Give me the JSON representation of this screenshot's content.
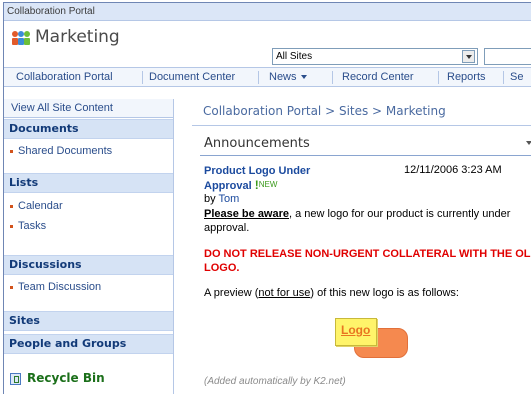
{
  "topbar": {
    "portal_name": "Collaboration Portal"
  },
  "site": {
    "title": "Marketing"
  },
  "search": {
    "scope_value": "All Sites",
    "query_value": ""
  },
  "topnav": {
    "tabs": [
      {
        "label": "Collaboration Portal"
      },
      {
        "label": "Document Center"
      },
      {
        "label": "News"
      },
      {
        "label": "Record Center"
      },
      {
        "label": "Reports"
      },
      {
        "label": "Se"
      }
    ]
  },
  "quicklaunch": {
    "view_all": "View All Site Content",
    "documents_header": "Documents",
    "documents_items": [
      "Shared Documents"
    ],
    "lists_header": "Lists",
    "lists_items": [
      "Calendar",
      "Tasks"
    ],
    "discussions_header": "Discussions",
    "discussions_items": [
      "Team Discussion"
    ],
    "sites_header": "Sites",
    "people_header": "People and Groups",
    "recycle_bin": "Recycle Bin"
  },
  "main": {
    "breadcrumb": "Collaboration Portal > Sites > Marketing",
    "webpart_title": "Announcements",
    "announcement": {
      "title_line1": "Product Logo Under",
      "title_line2": "Approval",
      "new_flag_mark": "!",
      "new_flag_text": "NEW",
      "date": "12/11/2006 3:23 AM",
      "by_prefix": "by",
      "author": "Tom",
      "para1_emphasis": "Please be aware",
      "para1_rest": ", a new logo for our product is currently under approval.",
      "warning": "DO NOT RELEASE NON-URGENT COLLATERAL WITH THE OLD LOGO.",
      "para2_before": "A preview (",
      "para2_link": "not for use",
      "para2_after": ") of this new logo is as follows:",
      "logo_word": "Logo",
      "footnote": "(Added automatically by K2.net)"
    }
  }
}
